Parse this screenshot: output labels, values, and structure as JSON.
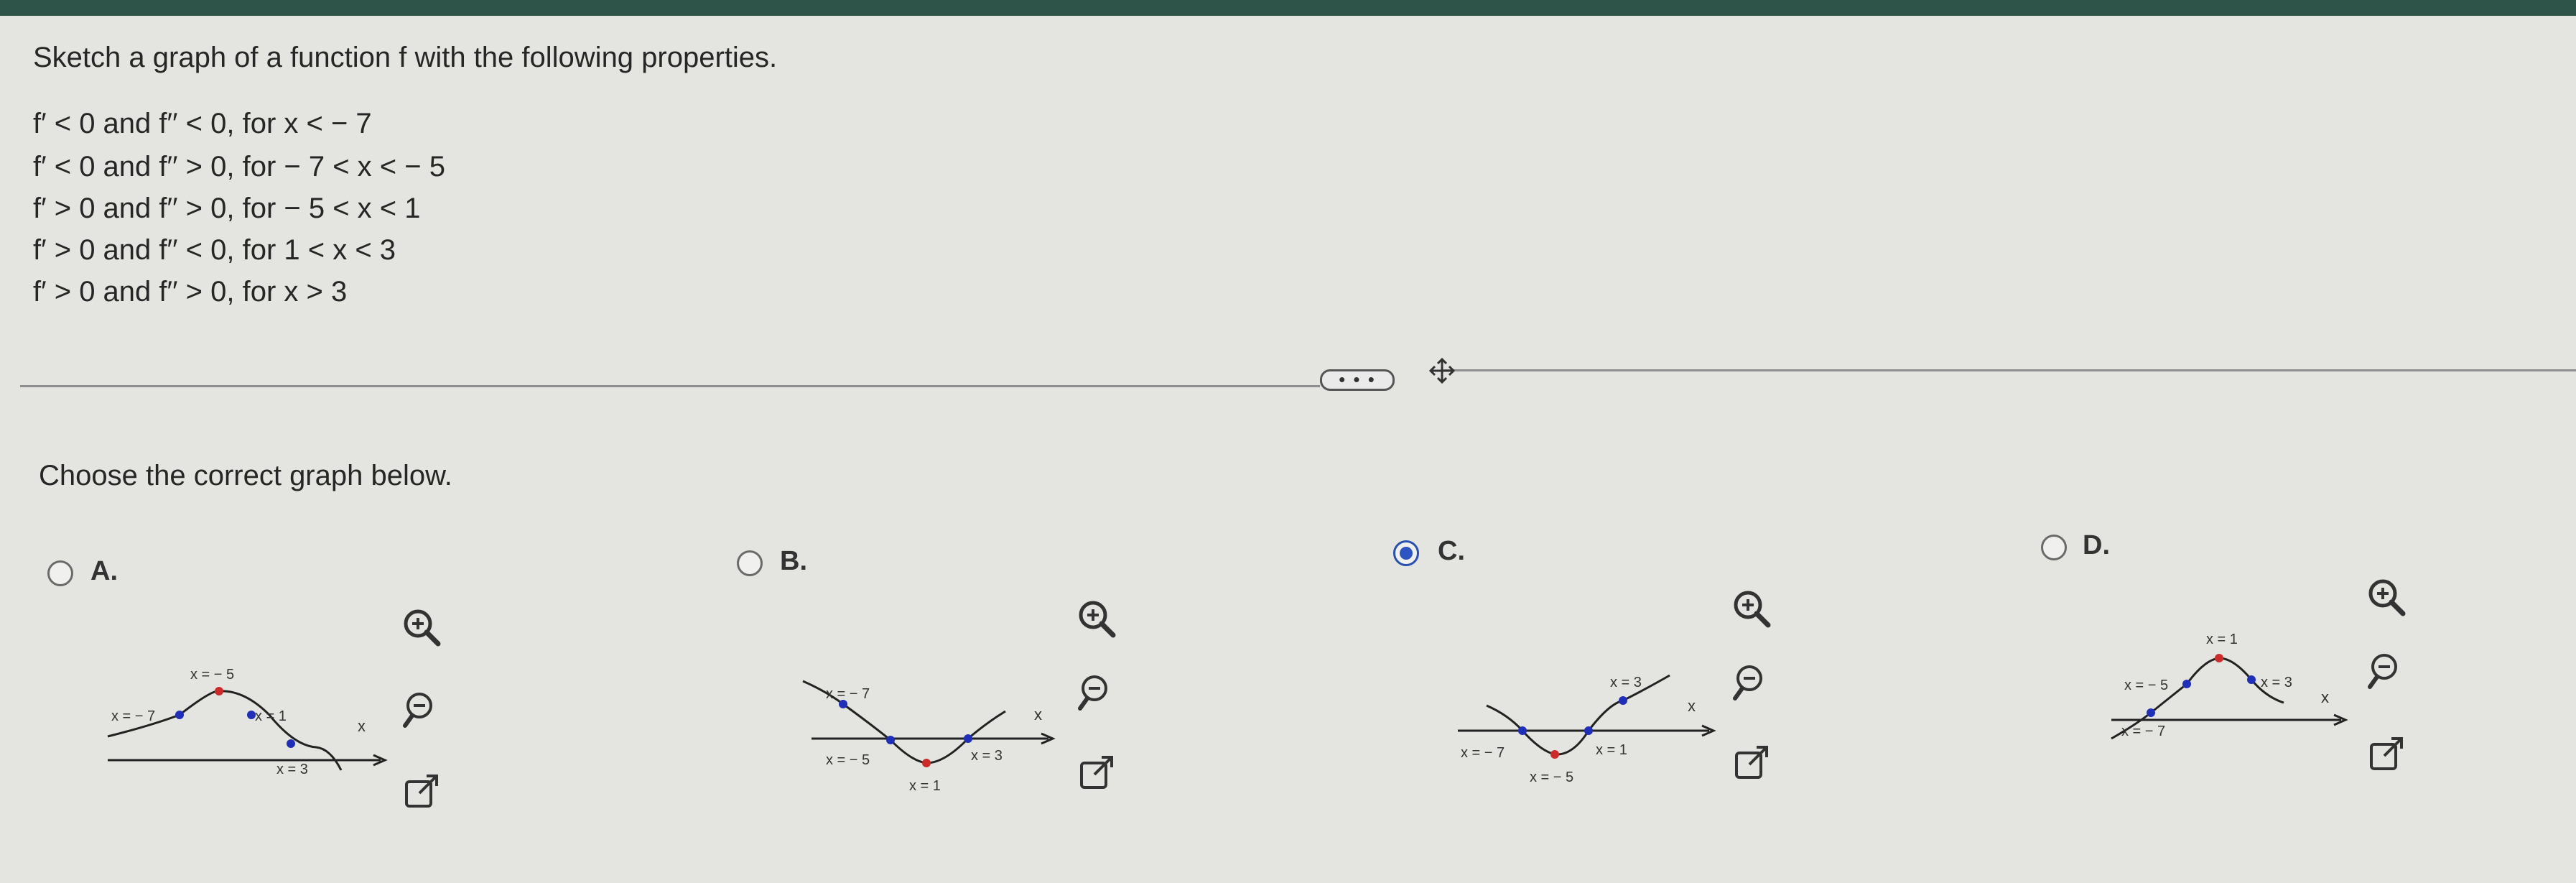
{
  "question": {
    "title": "Sketch a graph of a function f with the following properties.",
    "conditions": [
      "f′ < 0 and f′′ < 0, for x < − 7",
      "f′ < 0 and f′′ > 0, for − 7 < x < − 5",
      "f′ > 0 and f′′ > 0, for − 5 < x < 1",
      "f′ > 0 and f′′ < 0, for 1 < x < 3",
      "f′ > 0 and f′′ > 0, for x > 3"
    ]
  },
  "more_button": "• • •",
  "choose_label": "Choose the correct graph below.",
  "options": [
    {
      "letter": "A.",
      "selected": false,
      "labels": {
        "p1": "x = − 7",
        "p2": "x = − 5",
        "p3": "x = 1",
        "p4": "x = 3",
        "axis": "x"
      }
    },
    {
      "letter": "B.",
      "selected": false,
      "labels": {
        "p1": "x = − 7",
        "p2": "x = − 5",
        "p3": "x = 1",
        "p4": "x = 3",
        "axis": "x"
      }
    },
    {
      "letter": "C.",
      "selected": true,
      "labels": {
        "p1": "x = − 7",
        "p2": "x = − 5",
        "p3": "x = 1",
        "p4": "x = 3",
        "axis": "x"
      }
    },
    {
      "letter": "D.",
      "selected": false,
      "labels": {
        "p1": "x = − 7",
        "p2": "x = − 5",
        "p3": "x = 1",
        "p4": "x = 3",
        "axis": "x"
      }
    }
  ],
  "icons": {
    "zoom_in": "zoom-in-icon",
    "zoom_out": "zoom-out-icon",
    "popout": "external-link-icon",
    "move": "move-icon"
  },
  "colors": {
    "header": "#2e5449",
    "radio_selected": "#2d55c2",
    "inflection_point": "#1f2fb8",
    "extremum_point": "#cc2b2b"
  }
}
